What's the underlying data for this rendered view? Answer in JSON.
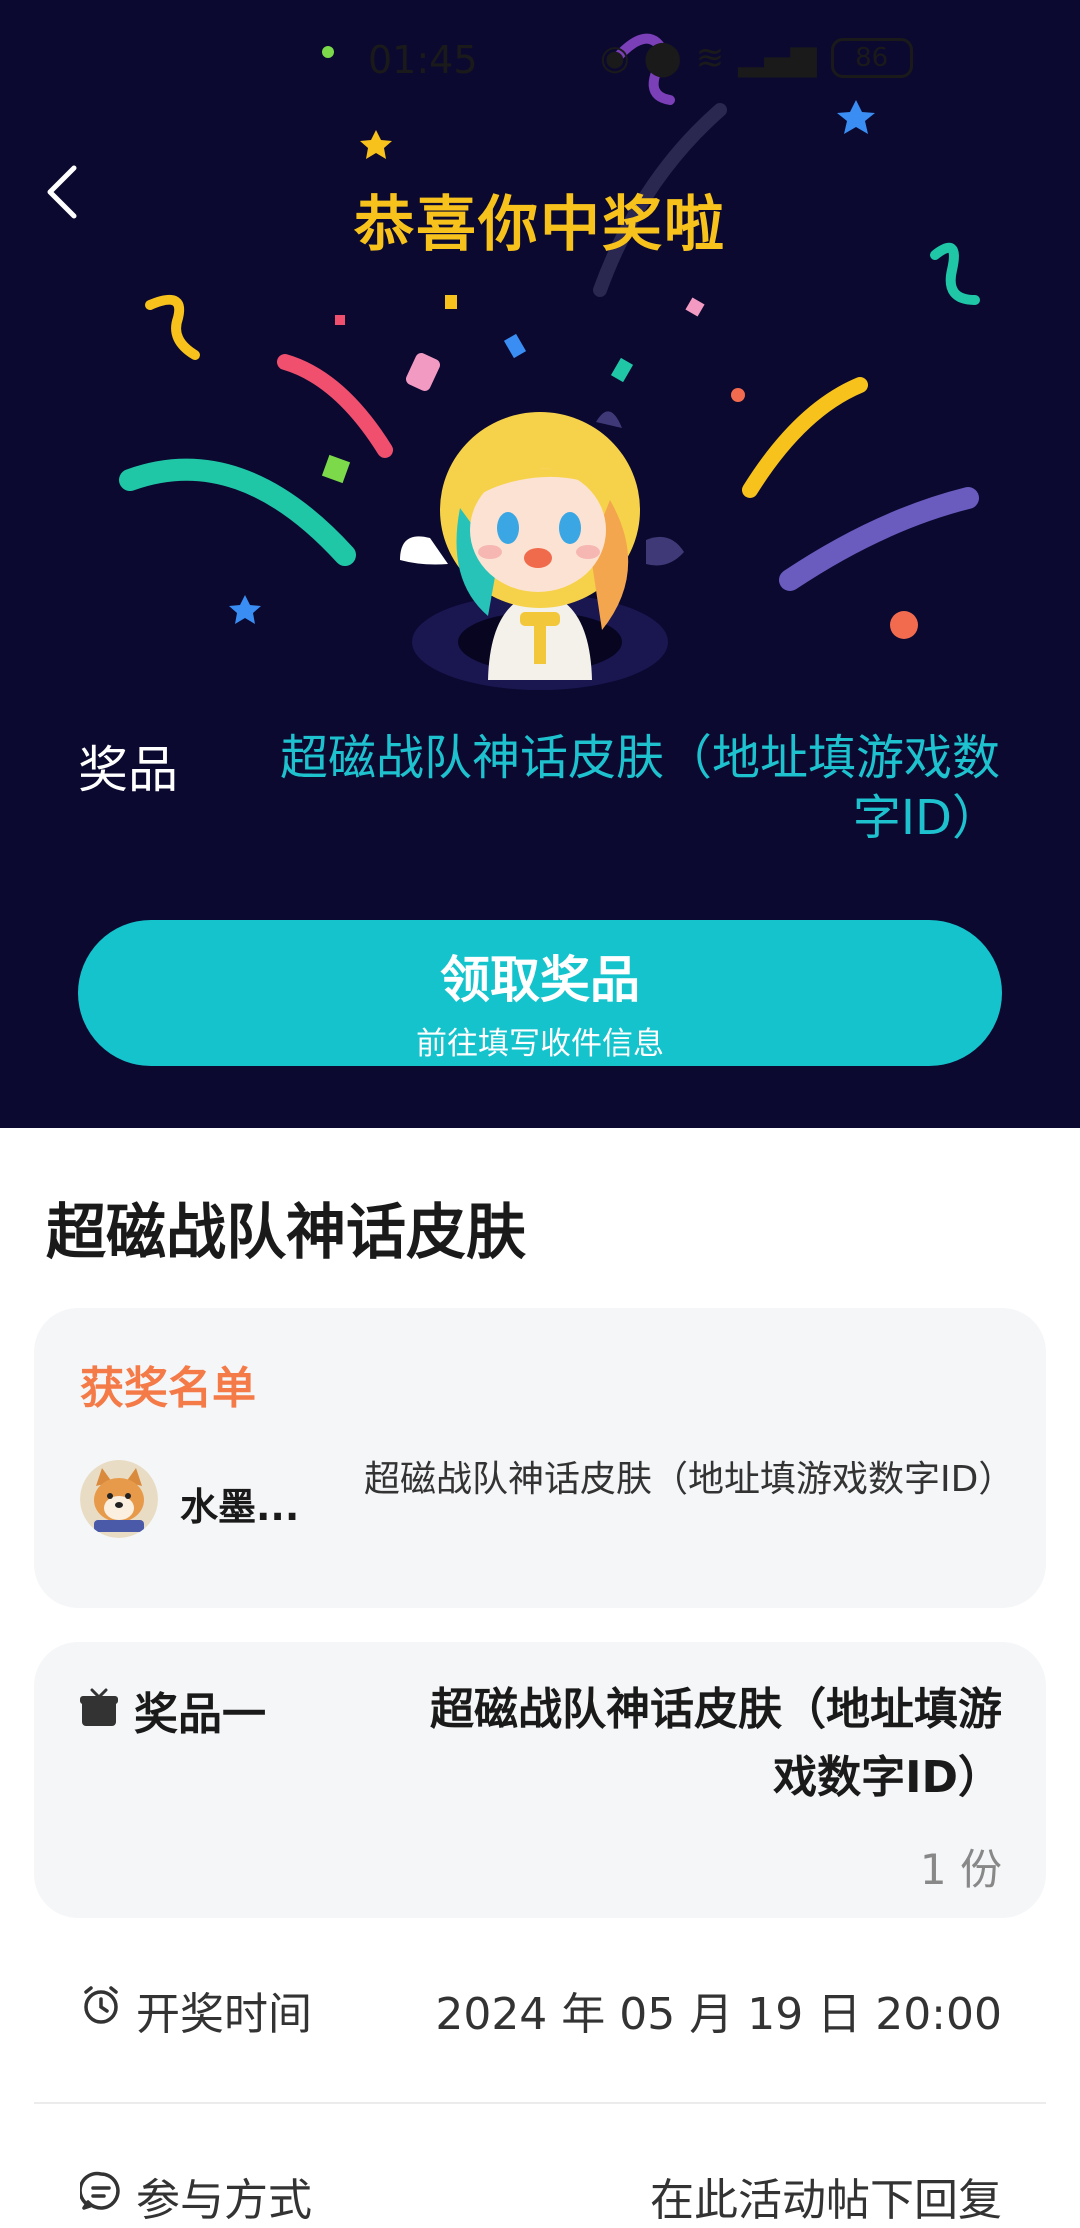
{
  "status_bar": {
    "time": "01:45",
    "battery": "86"
  },
  "hero": {
    "title": "恭喜你中奖啦",
    "prize_label": "奖品",
    "prize_value": "超磁战队神话皮肤（地址填游戏数字ID）",
    "claim_button": {
      "label": "领取奖品",
      "sublabel": "前往填写收件信息"
    }
  },
  "detail": {
    "title": "超磁战队神话皮肤",
    "winners": {
      "heading": "获奖名单",
      "items": [
        {
          "name": "水墨...",
          "prize": "超磁战队神话皮肤（地址填游戏数字ID）"
        }
      ]
    },
    "prize_one": {
      "label": "奖品一",
      "value": "超磁战队神话皮肤（地址填游戏数字ID）",
      "quantity": "1 份"
    },
    "draw_time": {
      "label": "开奖时间",
      "value": "2024 年 05 月 19 日 20:00"
    },
    "participation": {
      "label": "参与方式",
      "value": "在此活动帖下回复"
    }
  },
  "colors": {
    "hero_bg": "#0b0930",
    "title_gold": "#f7c21c",
    "accent_teal": "#15c3cd",
    "winners_orange": "#f47a48"
  }
}
